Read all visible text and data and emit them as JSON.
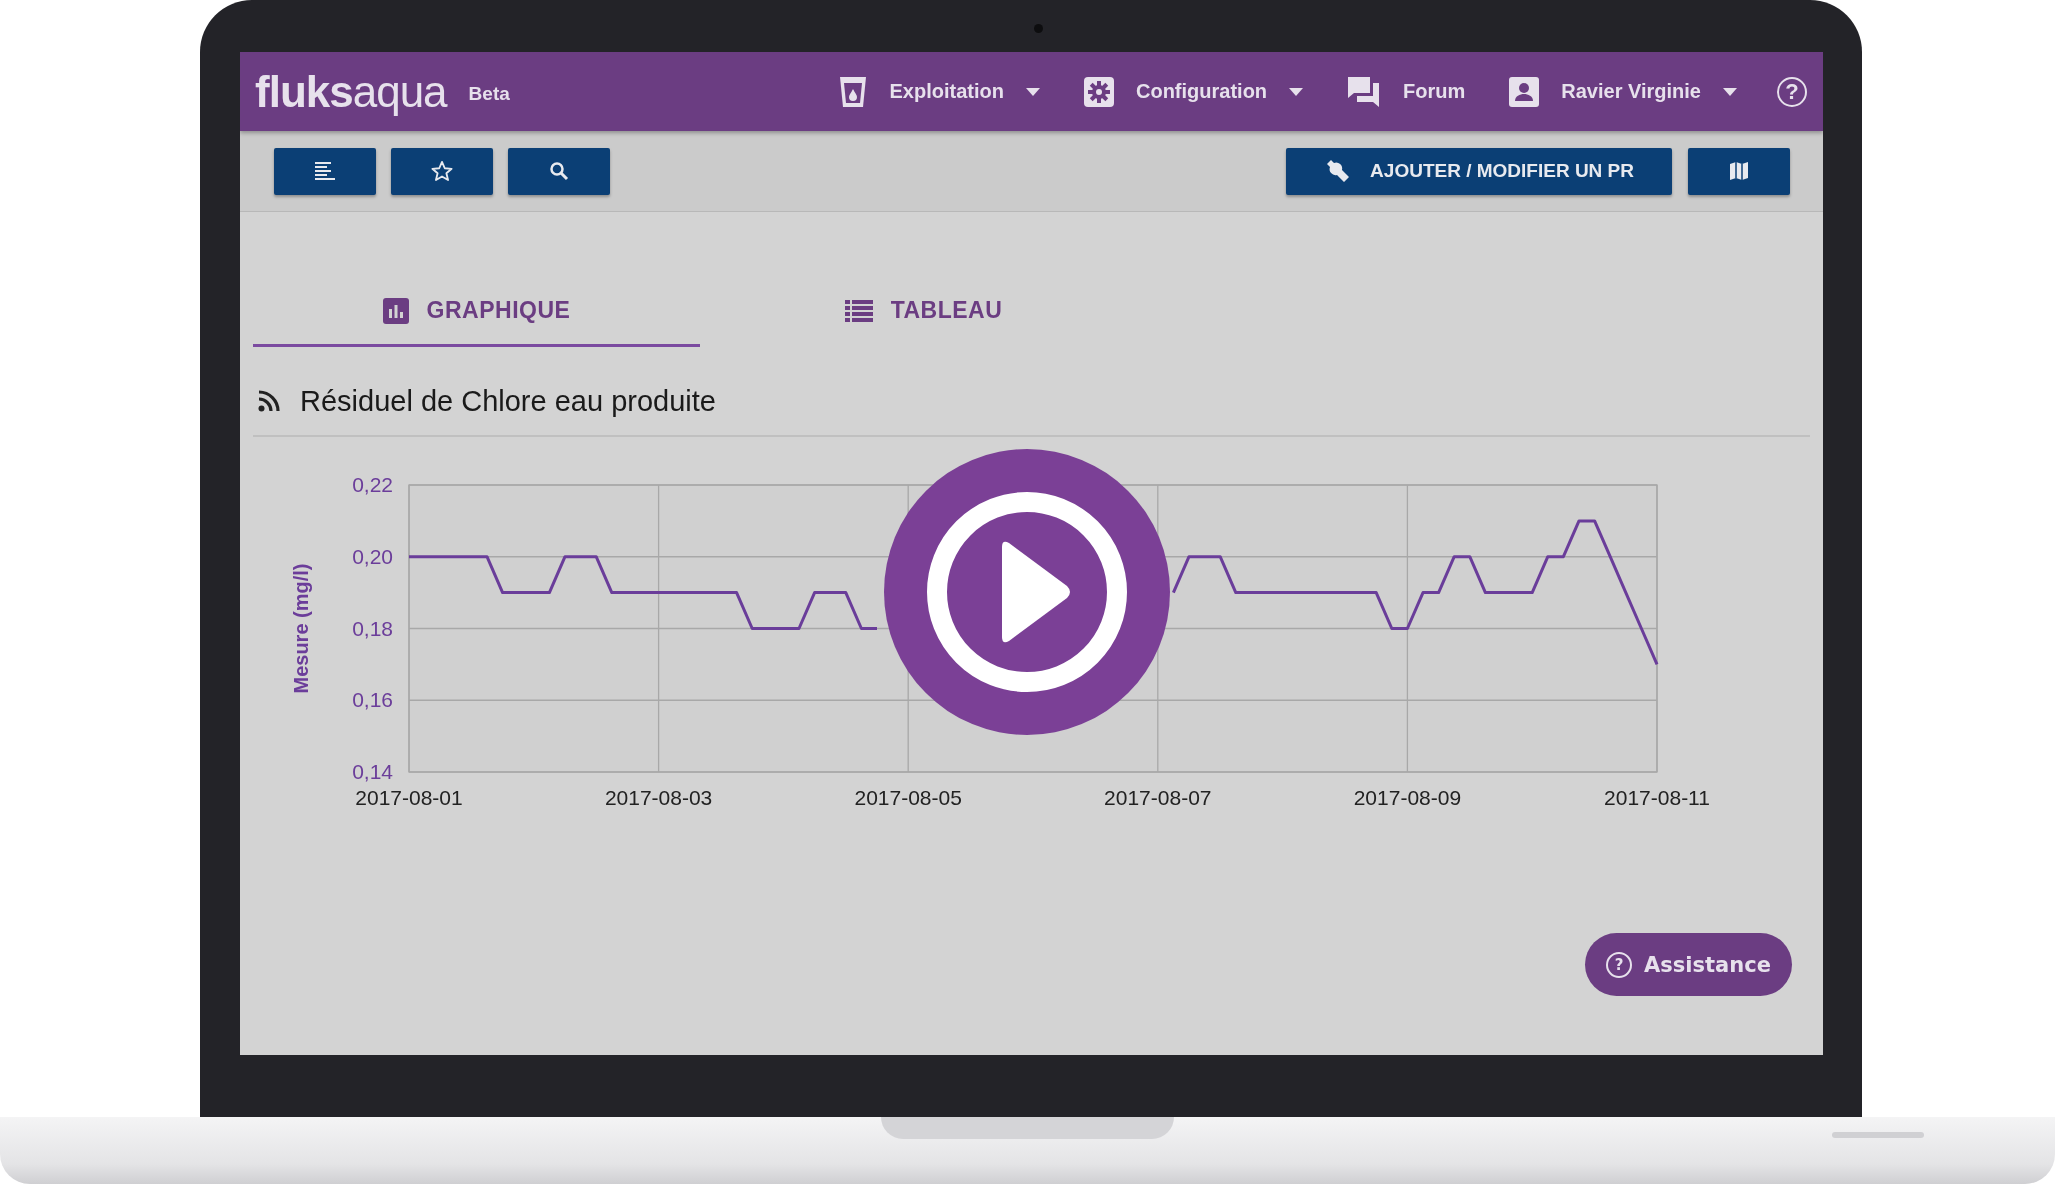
{
  "header": {
    "logo": "**fluks**aqua",
    "badge": "Beta",
    "nav": [
      {
        "kind": "cup",
        "label": "Exploitation",
        "dropdown": true
      },
      {
        "kind": "gear",
        "label": "Configuration",
        "dropdown": true
      },
      {
        "kind": "chat",
        "label": "Forum",
        "dropdown": false
      },
      {
        "kind": "user",
        "label": "Ravier Virginie",
        "dropdown": true
      }
    ],
    "help": "?"
  },
  "toolbar": {
    "left_buttons": [
      {
        "kind": "list"
      },
      {
        "kind": "star"
      },
      {
        "kind": "search"
      }
    ],
    "right_buttons": [
      {
        "kind": "wrench",
        "label": "AJOUTER / MODIFIER UN PR"
      },
      {
        "kind": "map"
      }
    ]
  },
  "tabs": [
    {
      "kind": "bar-chart",
      "label": "GRAPHIQUE",
      "selected": true
    },
    {
      "kind": "table",
      "label": "TABLEAU",
      "selected": false
    }
  ],
  "panel": {
    "title": "Résiduel de Chlore eau produite",
    "chart_data": {
      "type": "line",
      "grid": true,
      "ylabel": "Mesure (mg/l)",
      "ylim": [
        0.14,
        0.22
      ],
      "yticks": [
        {
          "value": 0.14,
          "label": "0,14"
        },
        {
          "value": 0.16,
          "label": "0,16"
        },
        {
          "value": 0.18,
          "label": "0,18"
        },
        {
          "value": 0.2,
          "label": "0,20"
        },
        {
          "value": 0.22,
          "label": "0,22"
        }
      ],
      "categories": [
        "2017-08-01",
        null,
        null,
        null,
        null,
        null,
        null,
        null,
        null,
        null,
        null,
        null,
        null,
        null,
        null,
        null,
        "2017-08-03",
        null,
        null,
        null,
        null,
        null,
        null,
        null,
        null,
        null,
        null,
        null,
        null,
        null,
        null,
        null,
        "2017-08-05",
        null,
        null,
        null,
        null,
        null,
        null,
        null,
        null,
        null,
        null,
        null,
        null,
        null,
        null,
        null,
        "2017-08-07",
        null,
        null,
        null,
        null,
        null,
        null,
        null,
        null,
        null,
        null,
        null,
        null,
        null,
        null,
        null,
        "2017-08-09",
        null,
        null,
        null,
        null,
        null,
        null,
        null,
        null,
        null,
        null,
        null,
        null,
        null,
        null,
        null,
        "2017-08-11"
      ],
      "series": [
        {
          "color": "#6a3d9a",
          "values": [
            0.2,
            0.2,
            0.2,
            0.2,
            0.2,
            0.2,
            0.19,
            0.19,
            0.19,
            0.19,
            0.2,
            0.2,
            0.2,
            0.19,
            0.19,
            0.19,
            0.19,
            0.19,
            0.19,
            0.19,
            0.19,
            0.19,
            0.18,
            0.18,
            0.18,
            0.18,
            0.19,
            0.19,
            0.19,
            0.18,
            0.18,
            null,
            null,
            null,
            null,
            null,
            null,
            null,
            null,
            null,
            null,
            null,
            null,
            null,
            null,
            null,
            null,
            null,
            null,
            0.19,
            0.2,
            0.2,
            0.2,
            0.19,
            0.19,
            0.19,
            0.19,
            0.19,
            0.19,
            0.19,
            0.19,
            0.19,
            0.19,
            0.18,
            0.18,
            0.19,
            0.19,
            0.2,
            0.2,
            0.19,
            0.19,
            0.19,
            0.19,
            0.2,
            0.2,
            0.21,
            0.21,
            0.2,
            0.19,
            0.18,
            0.17
          ]
        }
      ]
    }
  },
  "assistance": {
    "icon_text": "?",
    "label": "Assistance"
  }
}
